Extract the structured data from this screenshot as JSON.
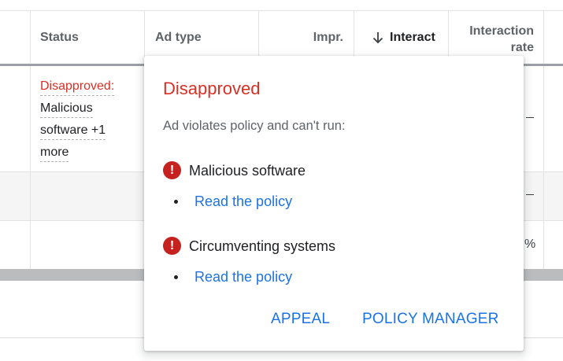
{
  "table": {
    "columns": [
      {
        "key": "status",
        "label": "Status"
      },
      {
        "key": "ad_type",
        "label": "Ad type"
      },
      {
        "key": "impr",
        "label": "Impr."
      },
      {
        "key": "interactions",
        "label": "Interact",
        "sort_icon": "arrow-down-icon"
      },
      {
        "key": "interaction_rate",
        "label_line1": "Interaction",
        "label_line2": "rate"
      }
    ],
    "rows": [
      {
        "status_lines": [
          "Disapproved:",
          "Malicious",
          "software +1",
          "more"
        ],
        "interaction_rate": "—"
      },
      {
        "interaction_rate": "—"
      },
      {
        "interaction_rate": "%"
      }
    ]
  },
  "popover": {
    "title": "Disapproved",
    "subtitle": "Ad violates policy and can't run:",
    "violations": [
      {
        "name": "Malicious software",
        "link": "Read the policy",
        "icon": "alert-icon"
      },
      {
        "name": "Circumventing systems",
        "link": "Read the policy",
        "icon": "alert-icon"
      }
    ],
    "actions": {
      "appeal": "APPEAL",
      "policy_manager": "POLICY MANAGER"
    }
  },
  "colors": {
    "error_red": "#d93025",
    "alert_icon": "#c5221f",
    "link_blue": "#1a73e8",
    "header_text": "#5f6368"
  }
}
